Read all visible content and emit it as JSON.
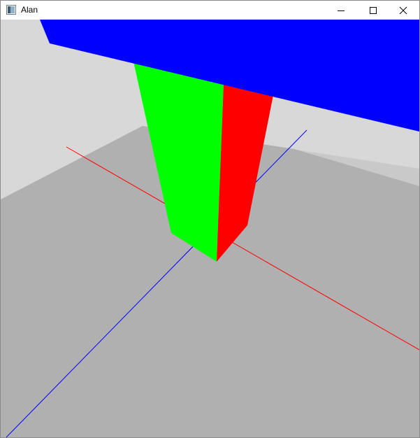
{
  "window": {
    "title": "Alan",
    "icons": {
      "app": "app-window-icon",
      "minimize": "minimize-icon",
      "maximize": "maximize-icon",
      "close": "close-icon"
    }
  },
  "scene": {
    "colors": {
      "background_wall": "#d8d8d8",
      "floor_far": "#c9c9c9",
      "floor": "#b0b0b0",
      "beam": "#0000ff",
      "pillar_left_face": "#00ff00",
      "pillar_right_face": "#ff0000",
      "axis_x": "#ff0000",
      "axis_z": "#0000ff"
    }
  }
}
